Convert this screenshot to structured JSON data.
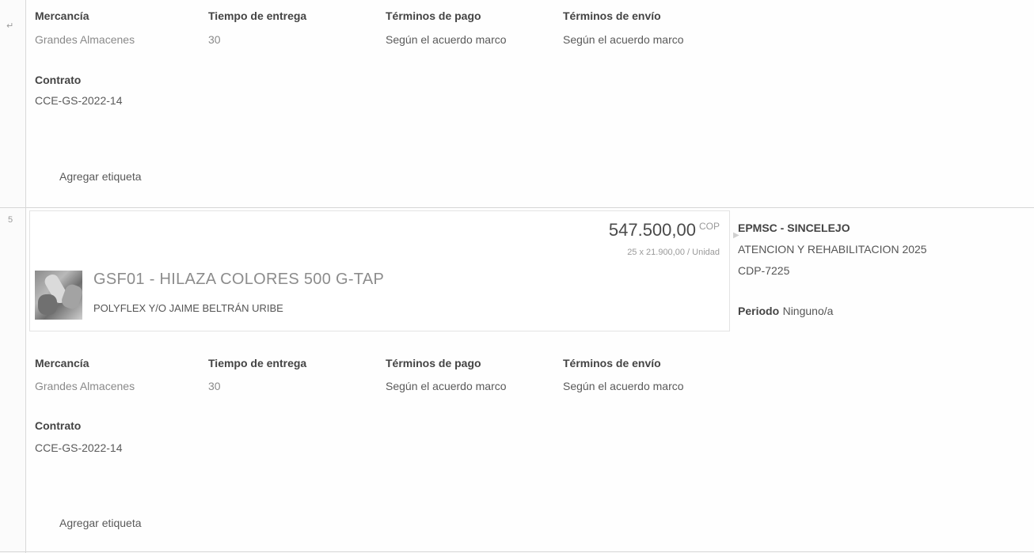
{
  "top_row": {
    "row_marker": "↵",
    "fields": [
      {
        "label": "Mercancía",
        "value": "Grandes Almacenes"
      },
      {
        "label": "Tiempo de entrega",
        "value": "30"
      },
      {
        "label": "Términos de pago",
        "value": "Según el acuerdo marco"
      },
      {
        "label": "Términos de envío",
        "value": "Según el acuerdo marco"
      }
    ],
    "contract": {
      "label": "Contrato",
      "value": "CCE-GS-2022-14"
    },
    "add_tag": "Agregar etiqueta"
  },
  "row5": {
    "row_number": "5",
    "price": "547.500,00",
    "currency": "COP",
    "unit_price": "25 x 21.900,00 / Unidad",
    "product_title": "GSF01 - HILAZA COLORES 500 G-TAP",
    "vendor": "POLYFLEX Y/O JAIME BELTRÁN URIBE",
    "buyer": {
      "name": "EPMSC - SINCELEJO",
      "program": "ATENCION Y REHABILITACION 2025",
      "cdp": "CDP-7225",
      "period_label": "Periodo",
      "period_value": "Ninguno/a"
    },
    "fields": [
      {
        "label": "Mercancía",
        "value": "Grandes Almacenes"
      },
      {
        "label": "Tiempo de entrega",
        "value": "30"
      },
      {
        "label": "Términos de pago",
        "value": "Según el acuerdo marco"
      },
      {
        "label": "Términos de envío",
        "value": "Según el acuerdo marco"
      }
    ],
    "contract": {
      "label": "Contrato",
      "value": "CCE-GS-2022-14"
    },
    "add_tag": "Agregar etiqueta"
  }
}
